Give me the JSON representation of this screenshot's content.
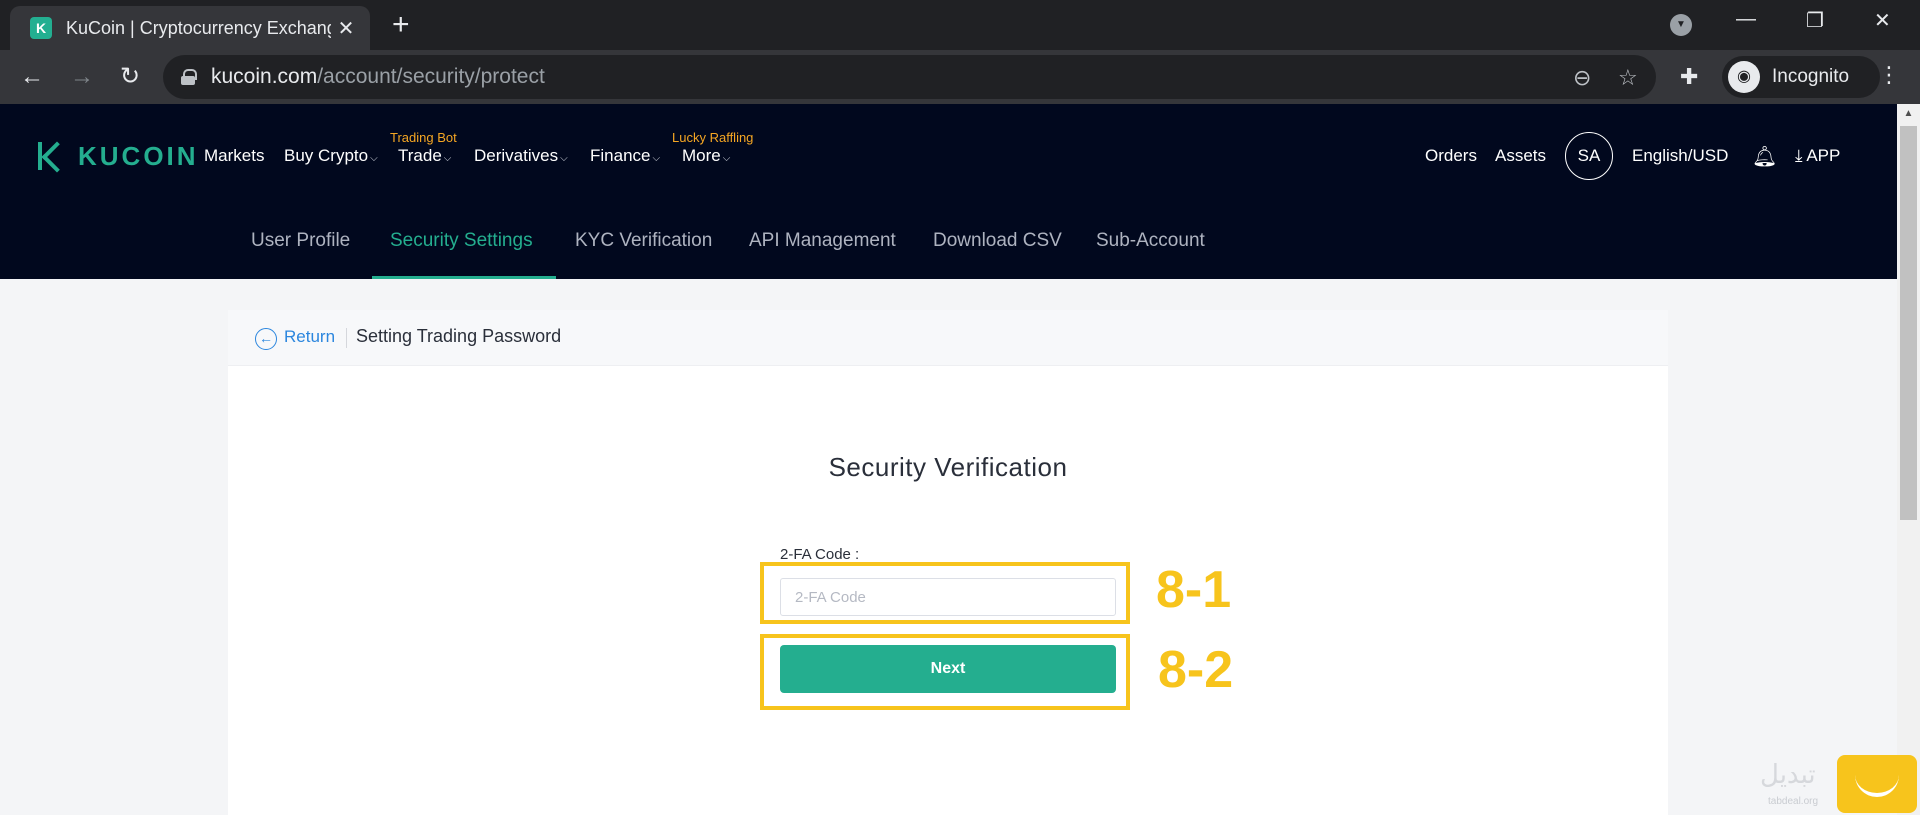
{
  "browser": {
    "tab_title": "KuCoin | Cryptocurrency Exchange",
    "favicon_letter": "K",
    "close_glyph": "✕",
    "new_tab_glyph": "+",
    "url_domain": "kucoin.com",
    "url_path": "/account/security/protect",
    "incognito_label": "Incognito",
    "win_controls": [
      "—",
      "❐",
      "✕"
    ]
  },
  "header": {
    "logo_text": "KUCOIN",
    "nav": [
      {
        "label": "Markets",
        "caret": false
      },
      {
        "label": "Buy Crypto",
        "caret": true
      },
      {
        "label": "Trade",
        "caret": true,
        "promo": "Trading Bot"
      },
      {
        "label": "Derivatives",
        "caret": true
      },
      {
        "label": "Finance",
        "caret": true
      },
      {
        "label": "More",
        "caret": true,
        "promo": "Lucky Raffling"
      }
    ],
    "orders": "Orders",
    "assets": "Assets",
    "avatar": "SA",
    "locale": "English/USD",
    "app": "APP"
  },
  "subnav": {
    "items": [
      "User Profile",
      "Security Settings",
      "KYC Verification",
      "API Management",
      "Download CSV",
      "Sub-Account"
    ],
    "active": "Security Settings"
  },
  "card": {
    "return_label": "Return",
    "title": "Setting Trading Password",
    "section_title": "Security Verification",
    "field_label": "2-FA Code :",
    "field_placeholder": "2-FA Code",
    "field_value": "",
    "next_label": "Next"
  },
  "annotations": {
    "input_label": "8-1",
    "button_label": "8-2",
    "color": "#f7c41c"
  },
  "watermark": {
    "text": "تبدیل",
    "sub": "tabdeal.org"
  },
  "colors": {
    "brand": "#24ae8f",
    "link": "#2b86de",
    "header_bg": "#01081e"
  }
}
